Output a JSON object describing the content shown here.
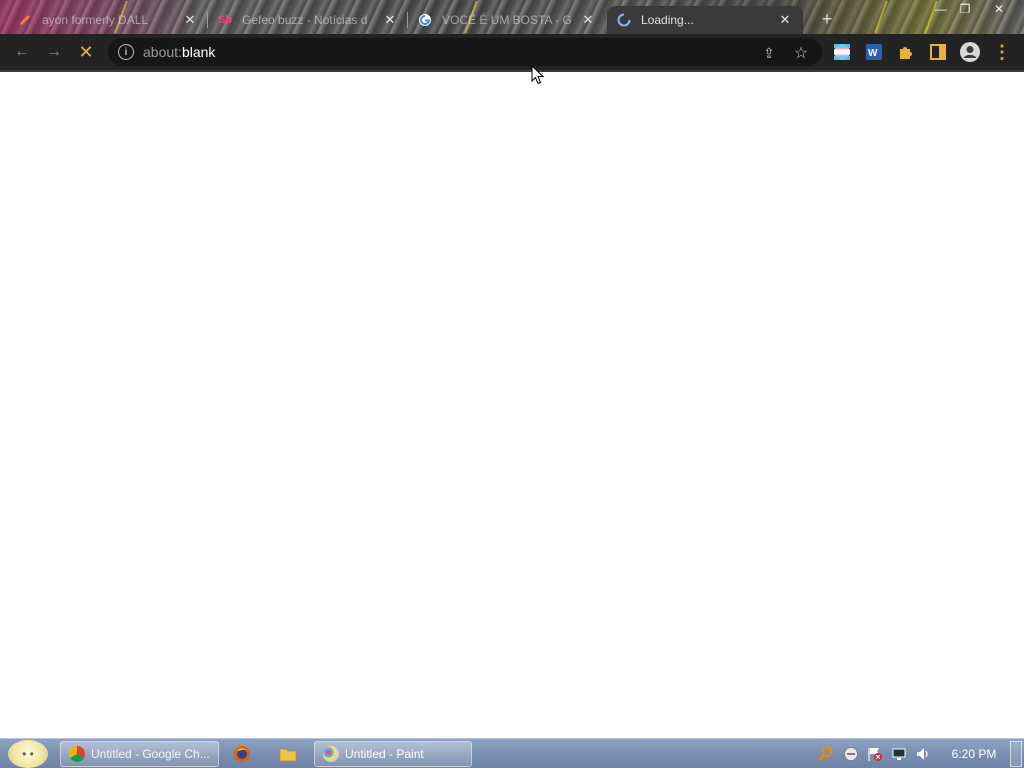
{
  "browser": {
    "tabs": [
      {
        "title": "ayon formerly DALL",
        "icon": "pencil-icon",
        "active": false
      },
      {
        "title": "Gefeo buzz - Notícias d",
        "icon": "sb-icon",
        "active": false
      },
      {
        "title": "VOCÊ É UM BOSTA - G",
        "icon": "google-icon",
        "active": false
      },
      {
        "title": "Loading...",
        "icon": "loading-spinner-icon",
        "active": true
      }
    ],
    "tab_close_glyph": "✕",
    "new_tab_glyph": "+",
    "window_controls": {
      "minimize": "—",
      "restore": "❐",
      "close": "✕"
    },
    "toolbar": {
      "back_glyph": "←",
      "forward_glyph": "→",
      "stop_glyph": "✕",
      "info_glyph": "i",
      "url_scheme": "about:",
      "url_host": "blank",
      "share_glyph": "⇪",
      "star_glyph": "☆",
      "menu_glyph": "⋮"
    },
    "extensions": [
      "flag-extension-icon",
      "w-extension-icon",
      "puzzle-icon",
      "sidepanel-icon",
      "profile-icon"
    ]
  },
  "taskbar": {
    "tasks": [
      {
        "label": "Untitled - Google Ch...",
        "icon": "chrome-icon"
      },
      {
        "label": "Untitled - Paint",
        "icon": "paint-icon"
      }
    ],
    "pinned": [
      "firefox-icon",
      "folder-icon"
    ],
    "tray": [
      "search-tray-icon",
      "messenger-tray-icon",
      "flag-tray-icon",
      "network-tray-icon",
      "volume-tray-icon"
    ],
    "clock": "6:20 PM"
  },
  "colors": {
    "toolbar_bg": "#232323",
    "accent_yellow": "#e8b23a",
    "page_bg": "#ffffff",
    "taskbar_bg": "#7b8fb0"
  }
}
